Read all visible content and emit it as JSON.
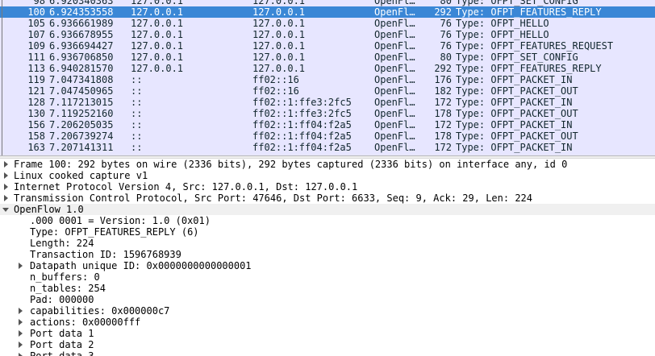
{
  "packets": [
    {
      "no": "98",
      "time": "6.920340363",
      "src": "127.0.0.1",
      "dst": "127.0.0.1",
      "proto": "OpenFl…",
      "len": "80",
      "info": "Type: OFPT_SET_CONFIG",
      "selected": false
    },
    {
      "no": "100",
      "time": "6.924353558",
      "src": "127.0.0.1",
      "dst": "127.0.0.1",
      "proto": "OpenFl…",
      "len": "292",
      "info": "Type: OFPT_FEATURES_REPLY",
      "selected": true
    },
    {
      "no": "105",
      "time": "6.936661989",
      "src": "127.0.0.1",
      "dst": "127.0.0.1",
      "proto": "OpenFl…",
      "len": "76",
      "info": "Type: OFPT_HELLO",
      "selected": false
    },
    {
      "no": "107",
      "time": "6.936678955",
      "src": "127.0.0.1",
      "dst": "127.0.0.1",
      "proto": "OpenFl…",
      "len": "76",
      "info": "Type: OFPT_HELLO",
      "selected": false
    },
    {
      "no": "109",
      "time": "6.936694427",
      "src": "127.0.0.1",
      "dst": "127.0.0.1",
      "proto": "OpenFl…",
      "len": "76",
      "info": "Type: OFPT_FEATURES_REQUEST",
      "selected": false
    },
    {
      "no": "111",
      "time": "6.936706850",
      "src": "127.0.0.1",
      "dst": "127.0.0.1",
      "proto": "OpenFl…",
      "len": "80",
      "info": "Type: OFPT_SET_CONFIG",
      "selected": false
    },
    {
      "no": "113",
      "time": "6.940281570",
      "src": "127.0.0.1",
      "dst": "127.0.0.1",
      "proto": "OpenFl…",
      "len": "292",
      "info": "Type: OFPT_FEATURES_REPLY",
      "selected": false
    },
    {
      "no": "119",
      "time": "7.047341808",
      "src": "::",
      "dst": "ff02::16",
      "proto": "OpenFl…",
      "len": "176",
      "info": "Type: OFPT_PACKET_IN",
      "selected": false
    },
    {
      "no": "121",
      "time": "7.047450965",
      "src": "::",
      "dst": "ff02::16",
      "proto": "OpenFl…",
      "len": "182",
      "info": "Type: OFPT_PACKET_OUT",
      "selected": false
    },
    {
      "no": "128",
      "time": "7.117213015",
      "src": "::",
      "dst": "ff02::1:ffe3:2fc5",
      "proto": "OpenFl…",
      "len": "172",
      "info": "Type: OFPT_PACKET_IN",
      "selected": false
    },
    {
      "no": "130",
      "time": "7.119252160",
      "src": "::",
      "dst": "ff02::1:ffe3:2fc5",
      "proto": "OpenFl…",
      "len": "178",
      "info": "Type: OFPT_PACKET_OUT",
      "selected": false
    },
    {
      "no": "156",
      "time": "7.206205035",
      "src": "::",
      "dst": "ff02::1:ff04:f2a5",
      "proto": "OpenFl…",
      "len": "172",
      "info": "Type: OFPT_PACKET_IN",
      "selected": false
    },
    {
      "no": "158",
      "time": "7.206739274",
      "src": "::",
      "dst": "ff02::1:ff04:f2a5",
      "proto": "OpenFl…",
      "len": "178",
      "info": "Type: OFPT_PACKET_OUT",
      "selected": false
    },
    {
      "no": "163",
      "time": "7.207141311",
      "src": "::",
      "dst": "ff02::1:ff04:f2a5",
      "proto": "OpenFl…",
      "len": "172",
      "info": "Type: OFPT_PACKET_IN",
      "selected": false
    }
  ],
  "details": [
    {
      "text": "Frame 100: 292 bytes on wire (2336 bits), 292 bytes captured (2336 bits) on interface any, id 0",
      "level": 0,
      "expander": "collapsed"
    },
    {
      "text": "Linux cooked capture v1",
      "level": 0,
      "expander": "collapsed"
    },
    {
      "text": "Internet Protocol Version 4, Src: 127.0.0.1, Dst: 127.0.0.1",
      "level": 0,
      "expander": "collapsed"
    },
    {
      "text": "Transmission Control Protocol, Src Port: 47646, Dst Port: 6633, Seq: 9, Ack: 29, Len: 224",
      "level": 0,
      "expander": "collapsed"
    },
    {
      "text": "OpenFlow 1.0",
      "level": 0,
      "expander": "expanded"
    },
    {
      "text": ".000 0001 = Version: 1.0 (0x01)",
      "level": 1,
      "expander": "none"
    },
    {
      "text": "Type: OFPT_FEATURES_REPLY (6)",
      "level": 1,
      "expander": "none"
    },
    {
      "text": "Length: 224",
      "level": 1,
      "expander": "none"
    },
    {
      "text": "Transaction ID: 1596768939",
      "level": 1,
      "expander": "none"
    },
    {
      "text": "Datapath unique ID: 0x0000000000000001",
      "level": 1,
      "expander": "collapsed"
    },
    {
      "text": "n_buffers: 0",
      "level": 1,
      "expander": "none"
    },
    {
      "text": "n_tables: 254",
      "level": 1,
      "expander": "none"
    },
    {
      "text": "Pad: 000000",
      "level": 1,
      "expander": "none"
    },
    {
      "text": "capabilities: 0x000000c7",
      "level": 1,
      "expander": "collapsed"
    },
    {
      "text": "actions: 0x00000fff",
      "level": 1,
      "expander": "collapsed"
    },
    {
      "text": "Port data 1",
      "level": 1,
      "expander": "collapsed"
    },
    {
      "text": "Port data 2",
      "level": 1,
      "expander": "collapsed"
    },
    {
      "text": "Port data 3",
      "level": 1,
      "expander": "collapsed"
    }
  ]
}
